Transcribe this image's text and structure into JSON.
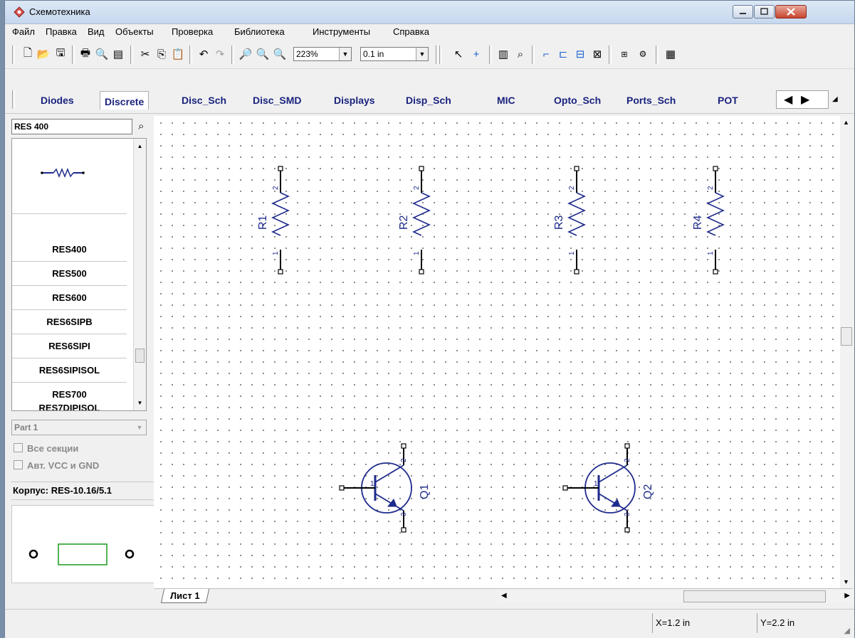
{
  "window": {
    "title": "Схемотехника"
  },
  "menu": [
    "Файл",
    "Правка",
    "Вид",
    "Объекты",
    "Проверка",
    "Библиотека",
    "Инструменты",
    "Справка"
  ],
  "toolbar": {
    "zoom": "223%",
    "grid": "0.1 in"
  },
  "libraries": {
    "tabs": [
      "Diodes",
      "Discrete",
      "Disc_Sch",
      "Disc_SMD",
      "Displays",
      "Disp_Sch",
      "MIC",
      "Opto_Sch",
      "Ports_Sch",
      "POT"
    ],
    "active": "Discrete"
  },
  "sidebar": {
    "search": "RES 400",
    "items": [
      "RES400",
      "RES500",
      "RES600",
      "RES6SIPB",
      "RES6SIPI",
      "RES6SIPISOL",
      "RES700",
      "RES7DIPISOL"
    ],
    "part": "Part 1",
    "check_all_sections": "Все секции",
    "check_auto_vcc": "Авт. VCC и GND",
    "package": "Корпус: RES-10.16/5.1"
  },
  "schematic": {
    "resistors": [
      "R1",
      "R2",
      "R3",
      "R4"
    ],
    "transistors": [
      "Q1",
      "Q2"
    ],
    "pin_labels": {
      "pin1": "1",
      "pin2": "2",
      "pin3": "3"
    }
  },
  "sheet_tab": "Лист 1",
  "status": {
    "x": "X=1.2 in",
    "y": "Y=2.2 in"
  },
  "colors": {
    "component": "#1e2a8c",
    "wire": "#000000",
    "footprint": "#1a9a1a"
  }
}
